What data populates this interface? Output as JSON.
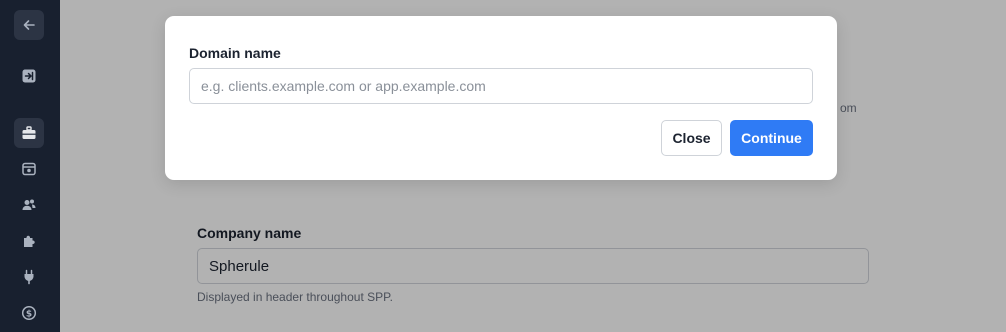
{
  "colors": {
    "sidebar_bg": "#18202f",
    "accent": "#2f7bf5",
    "overlay": "rgba(0,0,0,0.30)"
  },
  "sidebar": {
    "items": [
      {
        "icon": "arrow-left-icon"
      },
      {
        "icon": "sign-in-icon"
      },
      {
        "icon": "briefcase-icon",
        "active": true
      },
      {
        "icon": "inbox-icon"
      },
      {
        "icon": "users-icon"
      },
      {
        "icon": "puzzle-icon"
      },
      {
        "icon": "plug-icon"
      },
      {
        "icon": "dollar-circle-icon"
      }
    ]
  },
  "background": {
    "partial_text": "om",
    "company_name": {
      "label": "Company name",
      "value": "Spherule",
      "help": "Displayed in header throughout SPP."
    }
  },
  "modal": {
    "title": "Domain name",
    "input_placeholder": "e.g. clients.example.com or app.example.com",
    "input_value": "",
    "close_label": "Close",
    "continue_label": "Continue"
  }
}
